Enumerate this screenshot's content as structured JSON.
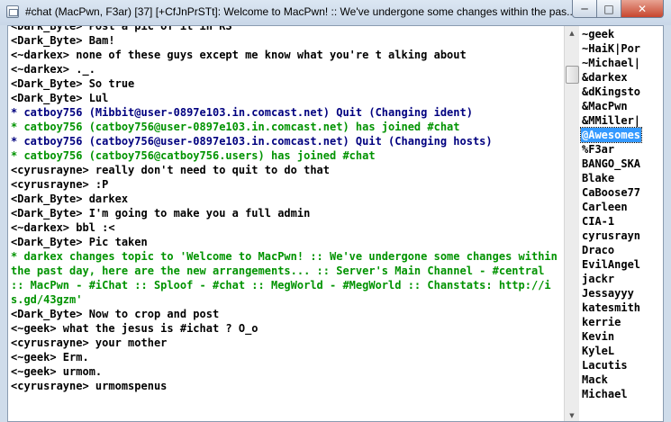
{
  "window": {
    "title": "#chat (MacPwn, F3ar) [37] [+CfJnPrSTt]: Welcome to MacPwn! :: We've undergone some changes within the pas...",
    "minimize_glyph": "─",
    "maximize_glyph": "□",
    "close_glyph": "✕"
  },
  "chat": {
    "lines": [
      {
        "type": "msg",
        "text": "<Dark_Byte> Post a pic of it in KS"
      },
      {
        "type": "msg",
        "text": "<Dark_Byte> Bam!"
      },
      {
        "type": "msg",
        "text": "<~darkex> none of these guys except me know what you're t alking about"
      },
      {
        "type": "msg",
        "text": "<~darkex> ._."
      },
      {
        "type": "msg",
        "text": "<Dark_Byte> So true"
      },
      {
        "type": "msg",
        "text": "<Dark_Byte> Lul"
      },
      {
        "type": "quit",
        "text": "* catboy756 (Mibbit@user-0897e103.in.comcast.net) Quit (Changing ident)"
      },
      {
        "type": "join",
        "text": "* catboy756 (catboy756@user-0897e103.in.comcast.net) has joined #chat"
      },
      {
        "type": "quit",
        "text": "* catboy756 (catboy756@user-0897e103.in.comcast.net) Quit (Changing hosts)"
      },
      {
        "type": "join",
        "text": "* catboy756 (catboy756@catboy756.users) has joined #chat"
      },
      {
        "type": "msg",
        "text": "<cyrusrayne> really don't need to quit to do that"
      },
      {
        "type": "msg",
        "text": "<cyrusrayne> :P"
      },
      {
        "type": "msg",
        "text": "<Dark_Byte> darkex"
      },
      {
        "type": "msg",
        "text": "<Dark_Byte> I'm going to make you a full admin"
      },
      {
        "type": "msg",
        "text": "<~darkex> bbl :<"
      },
      {
        "type": "msg",
        "text": "<Dark_Byte> Pic taken"
      },
      {
        "type": "topic",
        "text": "* darkex changes topic to 'Welcome to MacPwn! :: We've undergone some changes within the past day, here are the new arrangements... :: Server's Main Channel - #central :: MacPwn - #iChat :: Sploof - #chat :: MegWorld - #MegWorld :: Chanstats: http://is.gd/43gzm'"
      },
      {
        "type": "msg",
        "text": "<Dark_Byte> Now to crop and post"
      },
      {
        "type": "msg",
        "text": "<~geek> what the jesus is #ichat ? O_o"
      },
      {
        "type": "msg",
        "text": "<cyrusrayne> your mother"
      },
      {
        "type": "msg",
        "text": "<~geek> Erm."
      },
      {
        "type": "msg",
        "text": "<~geek> urmom."
      },
      {
        "type": "msg",
        "text": "<cyrusrayne> urmomspenus"
      }
    ]
  },
  "scrollbar": {
    "up_glyph": "▲",
    "down_glyph": "▼"
  },
  "nicklist": {
    "selected": "@Awesomes",
    "nicks": [
      "~geek",
      "~HaiK|Por",
      "~Michael|",
      "&darkex",
      "&dKingsto",
      "&MacPwn",
      "&MMiller|",
      "@Awesomes",
      "%F3ar",
      "BANGO_SKA",
      "Blake",
      "CaBoose77",
      "Carleen",
      "CIA-1",
      "cyrusrayn",
      "Draco",
      "EvilAngel",
      "jackr",
      "Jessayyy",
      "katesmith",
      "kerrie",
      "Kevin",
      "KyleL",
      "Lacutis",
      "Mack",
      "Michael"
    ]
  }
}
